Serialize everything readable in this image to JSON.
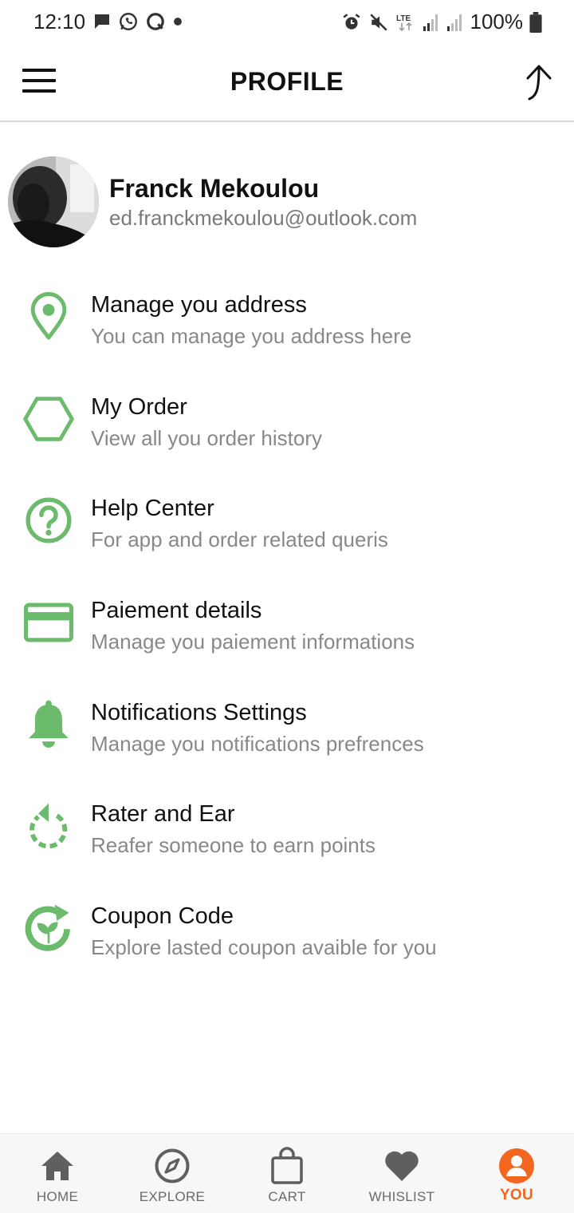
{
  "status_bar": {
    "time": "12:10",
    "battery_text": "100%",
    "icons_left": [
      "message-icon",
      "whatsapp-icon",
      "chat-bubble-icon",
      "dot-icon"
    ],
    "icons_right": [
      "alarm-icon",
      "mute-icon",
      "lte-icon",
      "signal-icon",
      "signal-icon",
      "battery-icon"
    ]
  },
  "app_bar": {
    "title": "PROFILE",
    "left_icon": "menu-icon",
    "right_icon": "share-arrow-icon"
  },
  "profile": {
    "name": "Franck Mekoulou",
    "email": "ed.franckmekoulou@outlook.com"
  },
  "menu": {
    "items": [
      {
        "icon": "location-pin-icon",
        "title": "Manage you address",
        "subtitle": "You can manage you address here"
      },
      {
        "icon": "hexagon-icon",
        "title": "My Order",
        "subtitle": "View all you order history"
      },
      {
        "icon": "help-circle-icon",
        "title": "Help Center",
        "subtitle": "For app and order related queris"
      },
      {
        "icon": "credit-card-icon",
        "title": "Paiement details",
        "subtitle": "Manage you paiement informations"
      },
      {
        "icon": "bell-icon",
        "title": "Notifications Settings",
        "subtitle": "Manage you notifications prefrences"
      },
      {
        "icon": "refresh-icon",
        "title": "Rater and Ear",
        "subtitle": "Reafer someone to earn points"
      },
      {
        "icon": "eco-refresh-icon",
        "title": "Coupon Code",
        "subtitle": "Explore lasted coupon avaible for you"
      }
    ]
  },
  "bottom_nav": {
    "items": [
      {
        "icon": "home-icon",
        "label": "HOME"
      },
      {
        "icon": "compass-icon",
        "label": "EXPLORE"
      },
      {
        "icon": "shopping-bag-icon",
        "label": "CART"
      },
      {
        "icon": "heart-icon",
        "label": "WHISLIST"
      },
      {
        "icon": "user-icon",
        "label": "YOU"
      }
    ],
    "active": "YOU"
  },
  "colors": {
    "accent_green": "#6cbb6c",
    "active_orange": "#f2661f",
    "nav_grey": "#5f5f5f"
  }
}
